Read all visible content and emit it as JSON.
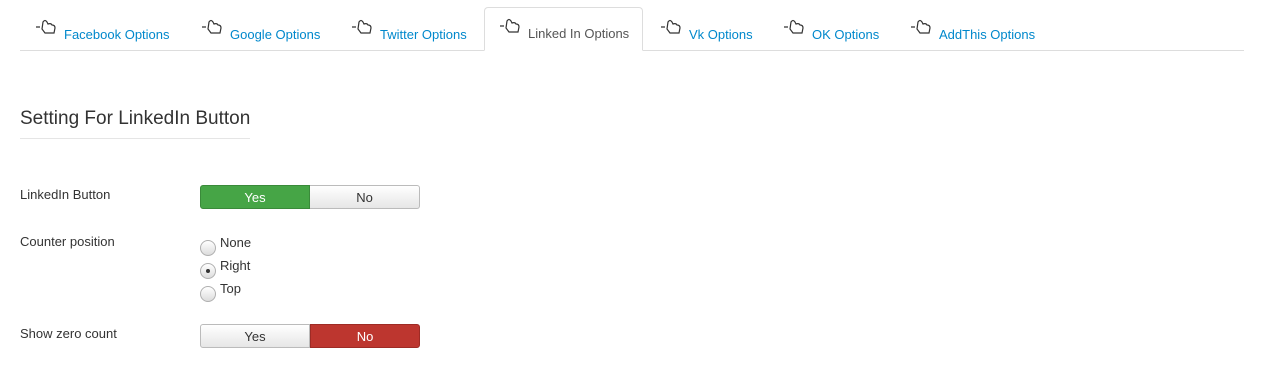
{
  "tabs": [
    {
      "label": "Facebook Options",
      "icon": "hand-pointer-icon",
      "active": false
    },
    {
      "label": "Google Options",
      "icon": "hand-pointer-icon",
      "active": false
    },
    {
      "label": "Twitter Options",
      "icon": "hand-pointer-icon",
      "active": false
    },
    {
      "label": "Linked In Options",
      "icon": "hand-pointer-icon",
      "active": true
    },
    {
      "label": "Vk Options",
      "icon": "hand-pointer-icon",
      "active": false
    },
    {
      "label": "OK Options",
      "icon": "hand-pointer-icon",
      "active": false
    },
    {
      "label": "AddThis Options",
      "icon": "hand-pointer-icon",
      "active": false
    }
  ],
  "section": {
    "title": "Setting For LinkedIn Button"
  },
  "linkedin_button": {
    "label": "LinkedIn Button",
    "yes": "Yes",
    "no": "No",
    "selected": "Yes"
  },
  "counter_position": {
    "label": "Counter position",
    "options": [
      "None",
      "Right",
      "Top"
    ],
    "selected": "Right"
  },
  "show_zero_count": {
    "label": "Show zero count",
    "yes": "Yes",
    "no": "No",
    "selected": "No"
  },
  "colors": {
    "link": "#0088cc",
    "yes_active": "#46a546",
    "no_active": "#bd362f"
  }
}
